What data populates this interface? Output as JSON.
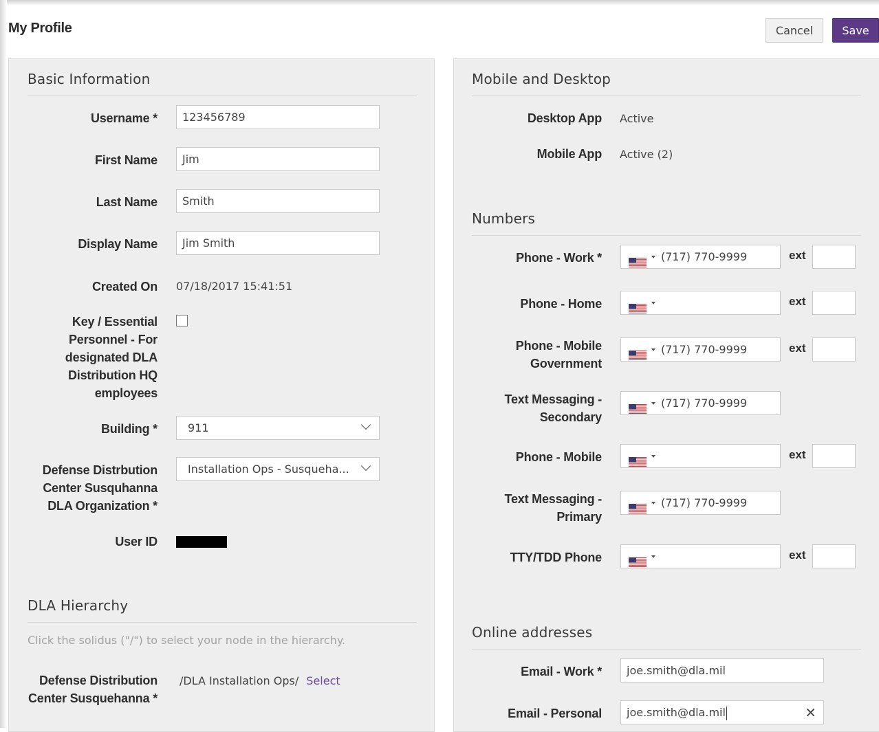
{
  "header": {
    "title": "My Profile",
    "cancel_label": "Cancel",
    "save_label": "Save"
  },
  "colors": {
    "accent": "#5c3a86",
    "panel_bg": "#eeeeee",
    "link": "#6a4a9a"
  },
  "basic_info": {
    "title": "Basic Information",
    "username_label": "Username *",
    "username_value": "123456789",
    "first_name_label": "First Name",
    "first_name_value": "Jim",
    "last_name_label": "Last Name",
    "last_name_value": "Smith",
    "display_name_label": "Display Name",
    "display_name_value": "Jim Smith",
    "created_on_label": "Created On",
    "created_on_value": "07/18/2017 15:41:51",
    "key_personnel_label_lines": [
      "Key / Essential",
      "Personnel - For",
      "designated DLA",
      "Distribution HQ",
      "employees"
    ],
    "key_personnel_checked": false,
    "building_label": "Building *",
    "building_value": "911",
    "org_label_lines": [
      "Defense Distrbution",
      "Center Susquhanna",
      "DLA Organization *"
    ],
    "org_value": "Installation Ops - Susqueha...",
    "user_id_label": "User ID"
  },
  "hierarchy": {
    "title": "DLA Hierarchy",
    "hint": "Click the solidus (\"/\") to select your node in the hierarchy.",
    "node_label_lines": [
      "Defense Distribution",
      "Center Susquehanna *"
    ],
    "node_path": "/DLA Installation Ops/",
    "select_label": "Select"
  },
  "mobile_desktop": {
    "title": "Mobile and Desktop",
    "desktop_label": "Desktop App",
    "desktop_value": "Active",
    "mobile_label": "Mobile App",
    "mobile_value": "Active (2)"
  },
  "numbers": {
    "title": "Numbers",
    "ext_label": "ext",
    "rows": [
      {
        "label1": "Phone - Work *",
        "label2": "",
        "number": "(717) 770-9999",
        "has_ext": true
      },
      {
        "label1": "Phone - Home",
        "label2": "",
        "number": "",
        "has_ext": true
      },
      {
        "label1": "Phone - Mobile",
        "label2": "Government",
        "number": "(717) 770-9999",
        "has_ext": true
      },
      {
        "label1": "Text Messaging -",
        "label2": "Secondary",
        "number": "(717) 770-9999",
        "has_ext": false
      },
      {
        "label1": "Phone - Mobile",
        "label2": "",
        "number": "",
        "has_ext": true
      },
      {
        "label1": "Text Messaging -",
        "label2": "Primary",
        "number": "(717) 770-9999",
        "has_ext": false
      },
      {
        "label1": "TTY/TDD Phone",
        "label2": "",
        "number": "",
        "has_ext": true
      }
    ]
  },
  "online": {
    "title": "Online addresses",
    "email_work_label": "Email - Work *",
    "email_work_value": "joe.smith@dla.mil",
    "email_personal_label": "Email - Personal",
    "email_personal_value": "joe.smith@dla.mil",
    "clear_icon": "×"
  }
}
